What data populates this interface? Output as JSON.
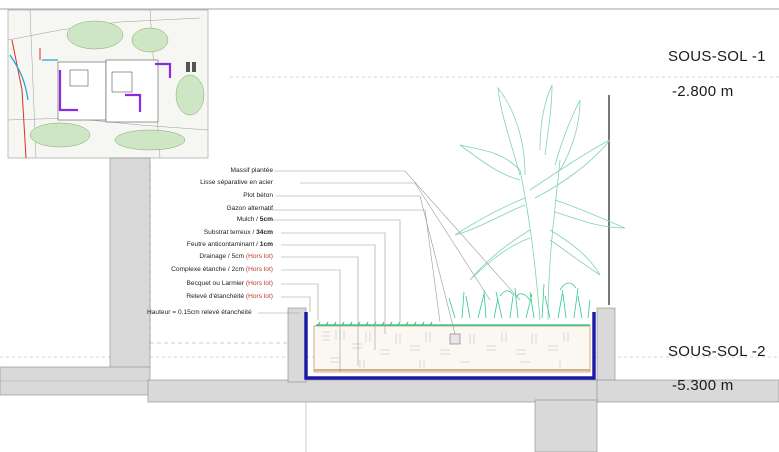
{
  "levels": [
    {
      "name": "SOUS-SOL -1",
      "elevation": "-2.800 m"
    },
    {
      "name": "SOUS-SOL -2",
      "elevation": "-5.300 m"
    }
  ],
  "callouts": [
    {
      "text": "Massif plantée",
      "bold": "",
      "note": ""
    },
    {
      "text": "Lisse séparative en acier",
      "bold": "",
      "note": ""
    },
    {
      "text": "Plot béton",
      "bold": "",
      "note": ""
    },
    {
      "text": "Gazon alternatif",
      "bold": "",
      "note": ""
    },
    {
      "text": "Mulch / ",
      "bold": "5cm",
      "note": ""
    },
    {
      "text": "Substrat terreux / ",
      "bold": "34cm",
      "note": ""
    },
    {
      "text": "Feutre anticontaminant / ",
      "bold": "1cm",
      "note": ""
    },
    {
      "text": "Drainage / 5cm ",
      "bold": "",
      "note": "(Hors lot)"
    },
    {
      "text": "Complexe étanche / 2cm ",
      "bold": "",
      "note": "(Hors lot)"
    },
    {
      "text": "Becquet ou Larmier ",
      "bold": "",
      "note": "(Hors lot)"
    },
    {
      "text": "Relevé d'étanchéité ",
      "bold": "",
      "note": "(Hors lot)"
    },
    {
      "text": "Hauteur = 0.15cm relevé étanchéité",
      "bold": "",
      "note": ""
    }
  ],
  "colors": {
    "waterproofing": "#1a1aa8",
    "planting": "#1fbf7a",
    "concrete": "#d9d9d9",
    "annotation_note": "#c0392b"
  }
}
